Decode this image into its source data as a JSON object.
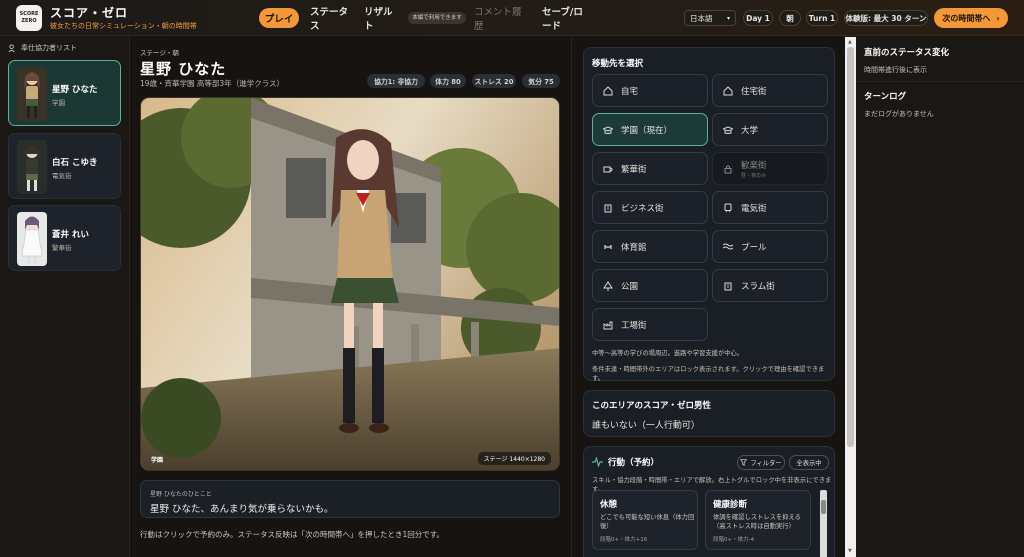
{
  "header": {
    "logo_text": "SCORE ZERO",
    "title": "スコア・ゼロ",
    "subtitle": "彼女たちの日常シミュレーション・朝の時間帯",
    "nav": {
      "play": "プレイ",
      "status": "ステータス",
      "result": "リザルト",
      "main_only_note": "本編で利用できます",
      "comment": "コメント履歴",
      "save_load": "セーブ/ロード"
    },
    "language": "日本語",
    "day": "Day 1",
    "time": "朝",
    "turn": "Turn 1",
    "trial": "体験版: 最大 30 ターン",
    "next_button": "次の時間帯へ",
    "accent_color": "#f29838"
  },
  "left_panel": {
    "heading": "奉仕協力者リスト",
    "characters": [
      {
        "name": "星野 ひなた",
        "location": "学園",
        "selected": true
      },
      {
        "name": "白石 こゆき",
        "location": "電気街",
        "selected": false
      },
      {
        "name": "蒼井 れい",
        "location": "繁華街",
        "selected": false
      }
    ]
  },
  "character": {
    "stage_label": "ステージ・朝",
    "name": "星野 ひなた",
    "profile": "19歳・斉華学園 高等部3年（進学クラス）",
    "stats": [
      "協力1: 非協力",
      "体力 80",
      "ストレス 20",
      "気分 75"
    ],
    "scene_location": "学園",
    "scene_resolution": "ステージ 1440×1280",
    "speech_speaker": "星野 ひなたのひとこと",
    "speech_text": "星野 ひなた、あんまり気が乗らないかも。",
    "hint": "行動はクリックで予約のみ。ステータス反映は「次の時間帯へ」を押したとき1回分です。"
  },
  "move": {
    "heading": "移動先を選択",
    "locations": [
      {
        "label": "自宅",
        "icon": "home-icon",
        "state": "normal"
      },
      {
        "label": "住宅街",
        "icon": "home-icon",
        "state": "normal"
      },
      {
        "label": "学園（現在）",
        "icon": "graduation-cap-icon",
        "state": "current"
      },
      {
        "label": "大学",
        "icon": "graduation-cap-icon",
        "state": "normal"
      },
      {
        "label": "繁華街",
        "icon": "coffee-icon",
        "state": "normal"
      },
      {
        "label": "歓楽街",
        "sub": "昼・夜のみ",
        "icon": "lock-icon",
        "state": "locked"
      },
      {
        "label": "ビジネス街",
        "icon": "building-icon",
        "state": "normal"
      },
      {
        "label": "電気街",
        "icon": "train-icon",
        "state": "normal"
      },
      {
        "label": "体育館",
        "icon": "dumbbell-icon",
        "state": "normal"
      },
      {
        "label": "プール",
        "icon": "waves-icon",
        "state": "normal"
      },
      {
        "label": "公園",
        "icon": "tree-icon",
        "state": "normal"
      },
      {
        "label": "スラム街",
        "icon": "building-icon",
        "state": "normal"
      },
      {
        "label": "工場街",
        "icon": "factory-icon",
        "state": "normal"
      }
    ],
    "note1": "中等〜高等の学びの場周辺。進路や学習支援が中心。",
    "note2": "条件未達・時間帯外のエリアはロック表示されます。クリックで理由を確認できます。"
  },
  "male_panel": {
    "heading": "このエリアのスコア・ゼロ男性",
    "value": "誰もいない（一人行動可）"
  },
  "actions": {
    "heading": "行動（予約）",
    "filter": "フィルター",
    "collapse_all": "全表示中",
    "note": "スキル・協力段階・時間帯・エリアで解放。右上トグルでロック中を非表示にできます。",
    "cards": [
      {
        "title": "休憩",
        "desc": "どこでも可能な短い休息（体力回復）",
        "stats": "段階0+・体力+16"
      },
      {
        "title": "健康診断",
        "desc": "体調を確認しストレスを抑える（高ストレス時は自動実行）",
        "stats": "段階0+・体力-4"
      }
    ]
  },
  "right_panel": {
    "status_heading": "直前のステータス変化",
    "status_text": "時間帯進行後に表示",
    "log_heading": "ターンログ",
    "log_text": "まだログがありません"
  }
}
